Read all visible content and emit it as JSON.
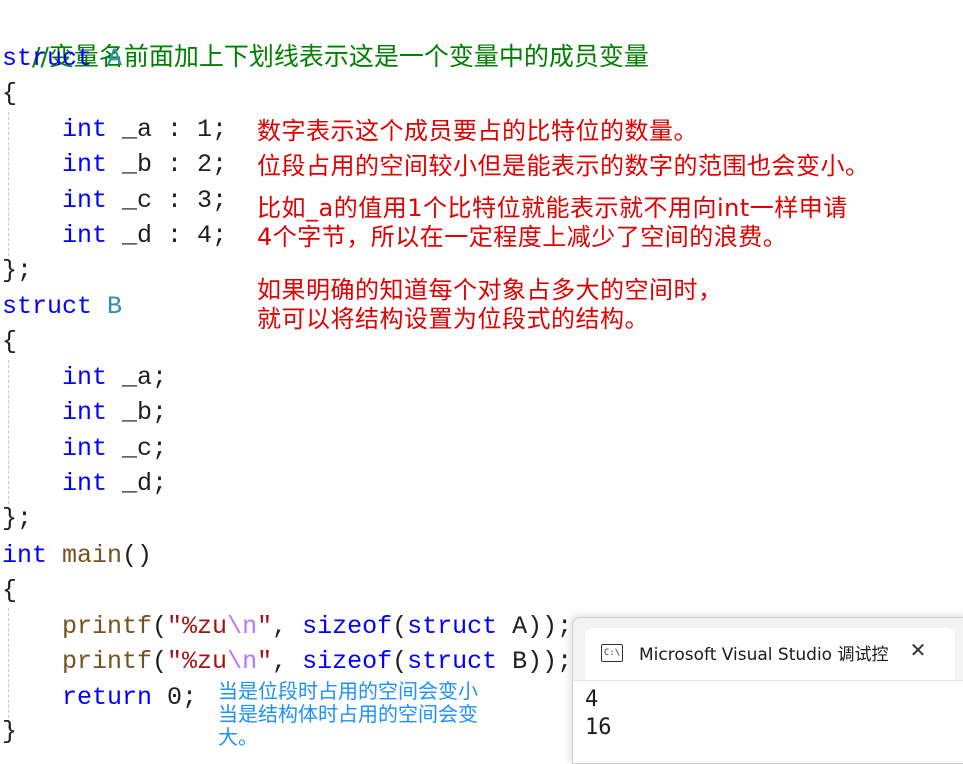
{
  "code": {
    "comment": "//变量名前面加上下划线表示这是一个变量中的成员变量",
    "kw_struct": "struct",
    "name_A": "A",
    "name_B": "B",
    "open_brace": "{",
    "close_brace": "};",
    "close_brace_main": "}",
    "kw_int": "int",
    "a_bits": "_a : 1;",
    "b_bits": "_b : 2;",
    "c_bits": "_c : 3;",
    "d_bits": "_d : 4;",
    "a_field": "_a;",
    "b_field": "_b;",
    "c_field": "_c;",
    "d_field": "_d;",
    "main_name": "main",
    "main_parens": "()",
    "printf": "printf",
    "paren_open": "(",
    "fmt_open": "\"%zu",
    "fmt_escape": "\\n",
    "fmt_close": "\"",
    "comma_space": ", ",
    "sizeof": "sizeof",
    "struct_arg": "struct",
    "arg_A_tail": " A));",
    "arg_B_tail": " B));",
    "kw_return": "return",
    "return_tail": " 0;"
  },
  "annotations": {
    "red_1": "数字表示这个成员要占的比特位的数量。",
    "red_2": "位段占用的空间较小但是能表示的数字的范围也会变小。",
    "red_3": "比如_a的值用1个比特位就能表示就不用向int一样申请",
    "red_4": "4个字节，所以在一定程度上减少了空间的浪费。",
    "red_5": "如果明确的知道每个对象占多大的空间时，",
    "red_6": "就可以将结构设置为位段式的结构。",
    "blue_1": "当是位段时占用的空间会变小",
    "blue_2": "当是结构体时占用的空间会变",
    "blue_3": "大。"
  },
  "console": {
    "icon_label": "C:\\",
    "title": "Microsoft Visual Studio 调试控",
    "close": "✕",
    "output_1": "4",
    "output_2": "16"
  }
}
